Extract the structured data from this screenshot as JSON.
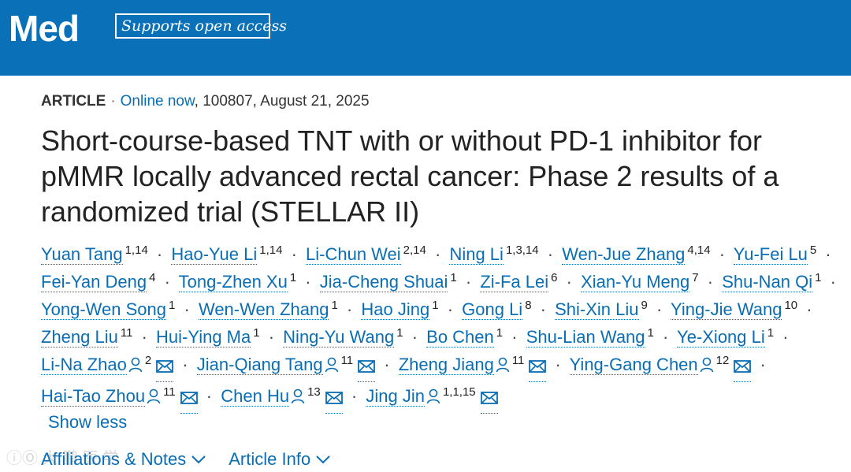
{
  "header": {
    "logo_text": "Med",
    "badge_text": "Supports open access",
    "bg_color": "#0a70b8"
  },
  "article": {
    "type": "ARTICLE",
    "status": "Online now",
    "id_date": ", 100807, August 21, 2025",
    "title": "Short-course-based TNT with or without PD-1 inhibitor for pMMR locally advanced rectal cancer: Phase 2 results of a randomized trial (STELLAR II)"
  },
  "authors": [
    {
      "name": "Yuan Tang",
      "sup": "1,14"
    },
    {
      "name": "Hao-Yue Li",
      "sup": "1,14"
    },
    {
      "name": "Li-Chun Wei",
      "sup": "2,14"
    },
    {
      "name": "Ning Li",
      "sup": "1,3,14"
    },
    {
      "name": "Wen-Jue Zhang",
      "sup": "4,14"
    },
    {
      "name": "Yu-Fei Lu",
      "sup": "5"
    },
    {
      "name": "Fei-Yan Deng",
      "sup": "4"
    },
    {
      "name": "Tong-Zhen Xu",
      "sup": "1"
    },
    {
      "name": "Jia-Cheng Shuai",
      "sup": "1"
    },
    {
      "name": "Zi-Fa Lei",
      "sup": "6"
    },
    {
      "name": "Xian-Yu Meng",
      "sup": "7"
    },
    {
      "name": "Shu-Nan Qi",
      "sup": "1"
    },
    {
      "name": "Yong-Wen Song",
      "sup": "1"
    },
    {
      "name": "Wen-Wen Zhang",
      "sup": "1"
    },
    {
      "name": "Hao Jing",
      "sup": "1"
    },
    {
      "name": "Gong Li",
      "sup": "8"
    },
    {
      "name": "Shi-Xin Liu",
      "sup": "9"
    },
    {
      "name": "Ying-Jie Wang",
      "sup": "10"
    },
    {
      "name": "Zheng Liu",
      "sup": "11"
    },
    {
      "name": "Hui-Ying Ma",
      "sup": "1"
    },
    {
      "name": "Ning-Yu Wang",
      "sup": "1"
    },
    {
      "name": "Bo Chen",
      "sup": "1"
    },
    {
      "name": "Shu-Lian Wang",
      "sup": "1"
    },
    {
      "name": "Ye-Xiong Li",
      "sup": "1"
    },
    {
      "name": "Li-Na Zhao",
      "sup": "2",
      "corresponding": true
    },
    {
      "name": "Jian-Qiang Tang",
      "sup": "11",
      "corresponding": true
    },
    {
      "name": "Zheng Jiang",
      "sup": "11",
      "corresponding": true
    },
    {
      "name": "Ying-Gang Chen",
      "sup": "12",
      "corresponding": true
    },
    {
      "name": "Hai-Tao Zhou",
      "sup": "11",
      "corresponding": true
    },
    {
      "name": "Chen Hu",
      "sup": "13",
      "corresponding": true
    },
    {
      "name": "Jing Jin",
      "sup": "1,1,15",
      "corresponding": true
    }
  ],
  "controls": {
    "show_less": "Show less",
    "affiliations": "Affiliations & Notes",
    "article_info": "Article Info"
  },
  "icons": {
    "person": "person-icon",
    "mail": "mail-icon",
    "chevron": "chevron-down-icon"
  },
  "link_color": "#0a6eb4"
}
